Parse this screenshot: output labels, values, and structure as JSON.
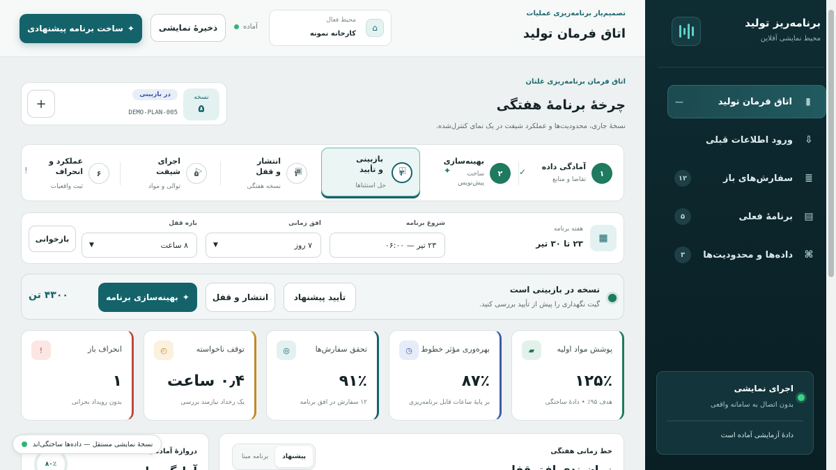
{
  "sidebar": {
    "brand_title": "برنامه‌ریز تولید",
    "brand_sub": "محیط نمایشی آفلاین",
    "items": [
      {
        "label": "اتاق فرمان تولید",
        "icon": "—",
        "badge": ""
      },
      {
        "label": "ورود اطلاعات قبلی",
        "icon": "⇩",
        "badge": ""
      },
      {
        "label": "سفارش‌های باز",
        "icon": "≣",
        "badge": "۱۲"
      },
      {
        "label": "برنامهٔ فعلی",
        "icon": "▤",
        "badge": "۵"
      },
      {
        "label": "داده‌ها و محدودیت‌ها",
        "icon": "⌘",
        "badge": "۳"
      }
    ],
    "demo": {
      "title": "اجرای نمایشی",
      "sub": "بدون اتصال به سامانه واقعی",
      "foot": "دادهٔ آزمایشی آماده است"
    }
  },
  "topbar": {
    "kicker": "تصمیم‌یار برنامه‌ریزی عملیات",
    "title": "اتاق فرمان تولید",
    "env_label": "محیط فعال",
    "env_value": "کارخانه نمونه",
    "status": "آماده",
    "save_label": "ذخیرهٔ نمایشی",
    "primary_label": "ساخت برنامه پیشنهادی"
  },
  "plan": {
    "kicker": "اتاق فرمان برنامه‌ریزی غلتان",
    "title": "چرخهٔ برنامهٔ هفتگی",
    "desc": "نسخهٔ جاری، محدودیت‌ها و عملکرد شیفت در یک نمای کنترل‌شده.",
    "version_label": "نسخه",
    "version_num": "۵",
    "version_state": "در بازبینی",
    "version_code": "DEMO-PLAN-005"
  },
  "steps": [
    {
      "num": "۱",
      "title": "آمادگی داده",
      "sub": "تقاضا و منابع",
      "icon": "✓"
    },
    {
      "num": "۲",
      "title": "بهینه‌سازی",
      "sub": "ساخت پیش‌نویس",
      "icon": "✦"
    },
    {
      "num": "۳",
      "title": "بازبینی و تأیید",
      "sub": "حل استثناها",
      "icon": "◫"
    },
    {
      "num": "۴",
      "title": "انتشار و قفل",
      "sub": "نسخه هفتگی",
      "icon": "▣"
    },
    {
      "num": "۵",
      "title": "اجرای شیفت",
      "sub": "توالی و مواد",
      "icon": "▷"
    },
    {
      "num": "۶",
      "title": "عملکرد و انحراف",
      "sub": "ثبت واقعیات",
      "icon": "!"
    }
  ],
  "controls": {
    "week_label": "هفته برنامه",
    "week_value": "۲۳ تا ۳۰ تیر",
    "start_label": "شروع برنامه",
    "start_value": "۲۳ تیر — ۰۶:۰۰",
    "horizon_label": "افق زمانی",
    "horizon_value": "۷ روز",
    "lock_label": "بازه قفل",
    "lock_value": "۸ ساعت",
    "reload_label": "بازخوانی"
  },
  "status": {
    "title": "نسخه در بازبینی است",
    "sub": "گیت نگهداری را پیش از تأیید بررسی کنید.",
    "approve_label": "تأیید پیشنهاد",
    "publish_label": "انتشار و قفل",
    "optimize_label": "بهینه‌سازی برنامه",
    "tonnage": "۴۳۰۰ تن"
  },
  "kpis": [
    {
      "title": "پوشش مواد اولیه",
      "value": "۱۲۵٪",
      "sub": "هدف ۹۵٪ • دادهٔ ساختگی",
      "color": "#1f7a5f",
      "icon": "▰",
      "icon_bg": "#e2f2ea"
    },
    {
      "title": "بهره‌وری مؤثر خطوط",
      "value": "۸۷٪",
      "sub": "بر پایهٔ ساعات قابل برنامه‌ریزی",
      "color": "#3b5ba9",
      "icon": "◷",
      "icon_bg": "#e6ecf8"
    },
    {
      "title": "تحقق سفارش‌ها",
      "value": "۹۱٪",
      "sub": "۱۲ سفارش در افق برنامه",
      "color": "#14636a",
      "icon": "◎",
      "icon_bg": "#e3f2f0"
    },
    {
      "title": "توقف ناخواسته",
      "value": "۰٫۴ ساعت",
      "sub": "یک رخداد نیازمند بررسی",
      "color": "#c08a22",
      "icon": "◴",
      "icon_bg": "#fbf1de"
    },
    {
      "title": "انحراف باز",
      "value": "۱",
      "sub": "بدون رویداد بحرانی",
      "color": "#c0463b",
      "icon": "!",
      "icon_bg": "#fbe6e3"
    }
  ],
  "timeline": {
    "title": "خط زمانی هفتگی",
    "big": "زمان‌بندی افق قفل",
    "seg_on": "پیشنهاد",
    "seg_off": "برنامه مبنا"
  },
  "gate": {
    "title": "دروازهٔ آمادگی",
    "big": "آمادگی داده",
    "ring": "۸۰٪"
  },
  "toast": "نسخهٔ نمایشی مستقل — داده‌ها ساختگی‌اند"
}
